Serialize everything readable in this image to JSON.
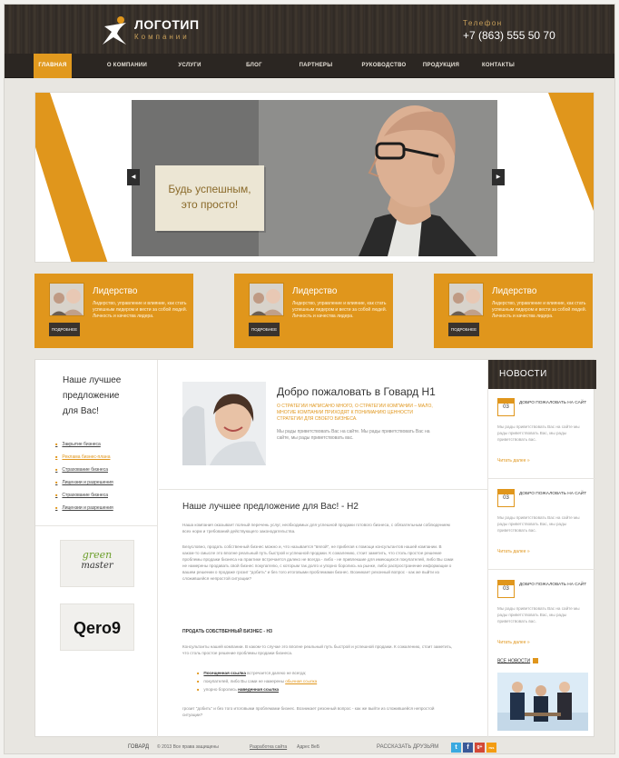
{
  "header": {
    "logo_title": "ЛОГОТИП",
    "logo_subtitle": "Компании",
    "phone_label": "Телефон",
    "phone_number": "+7 (863) 555 50 70"
  },
  "nav": {
    "items": [
      "ГЛАВНАЯ",
      "О КОМПАНИИ",
      "УСЛУГИ",
      "БЛОГ",
      "ПАРТНЕРЫ",
      "РУКОВОДСТВО",
      "ПРОДУКЦИЯ",
      "КОНТАКТЫ"
    ],
    "active_index": 0
  },
  "slider": {
    "line1": "Будь успешным,",
    "line2": "это просто!",
    "prev": "◀",
    "next": "▶"
  },
  "features": [
    {
      "title": "Лидерство",
      "text": "Лидерство, управление и влияние, как стать успешным лидером и вести за собой людей. Личность и качества лидера.",
      "button": "ПОДРОБНЕЕ"
    },
    {
      "title": "Лидерство",
      "text": "Лидерство, управление и влияние, как стать успешным лидером и вести за собой людей. Личность и качества лидера.",
      "button": "ПОДРОБНЕЕ"
    },
    {
      "title": "Лидерство",
      "text": "Лидерство, управление и влияние, как стать успешным лидером и вести за собой людей. Личность и качества лидера.",
      "button": "ПОДРОБНЕЕ"
    }
  ],
  "sidebar_left": {
    "title_line1": "Наше лучшее",
    "title_line2": "предложение",
    "title_line3": "для Вас!",
    "links": [
      "Закрытие бизнеса",
      "Реклама бизнес-плана",
      "Страхование бизнеса",
      "Лицензии и разрешения",
      "Страхование бизнеса",
      "Лицензии и разрешения"
    ],
    "partner1_line1": "green",
    "partner1_line2": "master",
    "partner2": "Qero9"
  },
  "content": {
    "welcome_title": "Добро пожаловать в Говард H1",
    "welcome_orange": "О СТРАТЕГИИ НАПИСАНО МНОГО, О СТРАТЕГИИ КОМПАНИИ – МАЛО, МНОГИЕ КОМПАНИИ ПРИХОДЯТ К ПОНИМАНИЮ ЦЕННОСТИ СТРАТЕГИИ ДЛЯ СВОЕГО БИЗНЕСА.",
    "welcome_grey": "Мы рады приветствовать Вас на сайте. Мы рады приветствовать Вас на сайте, мы рады приветствовать вас.",
    "h2": "Наше лучшее предложение для Вас! - H2",
    "para1": "Наша компания оказывает полный перечень услуг, необходимых для успешной продажи готового бизнеса, с обязательным соблюдением всех норм и требований действующего законодательства.",
    "para2": "Безусловно, продать собственный бизнес можно и, что называется \"вялой\", не прибегая к помощи консультантов нашей компании. В каком-то смысле это вполне реальный путь быстрой и успешной продажи. К сожалению, стоит заметить, что столь простое решение проблемы продажи бизнеса на практике встречается далеко не всегда - либо - не привлекшие для имеющихся покупателей, либо Вы сами не намерены продавать свой бизнес покупателю, с которым так долго и упорно боролись на рынке, либо распространение информации о вашем решении о продаже грозит \"добить\" и без того итоговыми проблемами бизнес. Возникает резонный вопрос - как же выйти из сложившейся непростой ситуации?",
    "h3": "ПРОДАТЬ СОБСТВЕННЫЙ БИЗНЕС - H3",
    "para3": "Консультанты нашей компании. В каком-то случае это вполне реальный путь быстрой и успешной продажи. К сожалению, стоит заметить, что столь простое решение проблемы продажи бизнеса.",
    "bullet1_link": "Посещенная ссылка",
    "bullet1_rest": " встречается далеко не всегда;",
    "bullet2_text": "покупателей, либо Вы сами не намерены ",
    "bullet2_link": "обычная ссылка",
    "bullet3_text": "упорно боролись ",
    "bullet3_link": "наведенная ссылка",
    "para4": "грозит \"добить\" и без того итоговыми проблемами бизнес. Возникает резонный вопрос - как же выйти из сложившейся непростой ситуации?"
  },
  "news": {
    "header": "НОВОСТИ",
    "items": [
      {
        "day": "03",
        "title": "ДОБРО ПОЖАЛОВАТЬ НА САЙТ",
        "text": "Мы рады приветствовать Вас на сайте мы рады приветствовать Вас, мы рады приветствовать вас.",
        "more": "Читать далее »"
      },
      {
        "day": "03",
        "title": "ДОБРО ПОЖАЛОВАТЬ НА САЙТ",
        "text": "Мы рады приветствовать Вас на сайте мы рады приветствовать Вас, мы рады приветствовать вас.",
        "more": "Читать далее »"
      },
      {
        "day": "03",
        "title": "ДОБРО ПОЖАЛОВАТЬ НА САЙТ",
        "text": "Мы рады приветствовать Вас на сайте мы рады приветствовать Вас, мы рады приветствовать вас.",
        "more": "Читать далее »"
      }
    ],
    "all_news": "ВСЕ НОВОСТИ"
  },
  "footer": {
    "brand": "ГОВАРД",
    "copyright": "© 2013 Все права защищены",
    "dev": "Разработка сайта",
    "dev_name": "Адрес ВеБ",
    "share": "РАССКАЗАТЬ ДРУЗЬЯМ",
    "social": [
      "t",
      "f",
      "g+",
      "rss"
    ]
  },
  "colors": {
    "accent": "#e0961c",
    "header_bg": "#332c26",
    "page_bg": "#e8e6e1"
  }
}
